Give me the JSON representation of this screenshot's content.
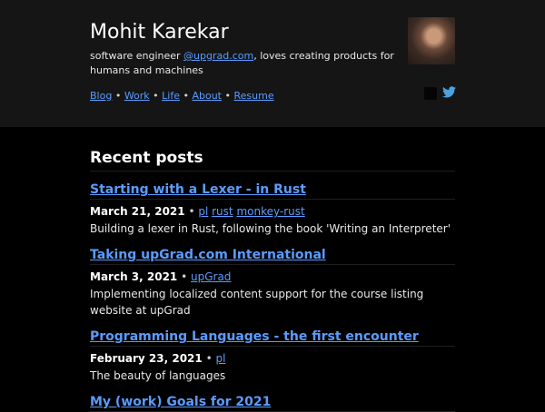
{
  "header": {
    "name": "Mohit Karekar",
    "bio_prefix": "software engineer ",
    "bio_link": "@upgrad.com",
    "bio_suffix": ", loves creating products for humans and machines",
    "nav": [
      "Blog",
      "Work",
      "Life",
      "About",
      "Resume"
    ],
    "nav_separator": " • "
  },
  "social": {
    "icons": [
      "github-icon",
      "twitter-icon"
    ],
    "twitter_color": "#4aa3df"
  },
  "main": {
    "section_title": "Recent posts",
    "posts": [
      {
        "title": "Starting with a Lexer - in Rust",
        "date": "March 21, 2021",
        "tags": [
          "pl",
          "rust",
          "monkey-rust"
        ],
        "description": "Building a lexer in Rust, following the book 'Writing an Interpreter'"
      },
      {
        "title": "Taking upGrad.com International",
        "date": "March 3, 2021",
        "tags": [
          "upGrad"
        ],
        "description": "Implementing localized content support for the course listing website at upGrad"
      },
      {
        "title": "Programming Languages - the first encounter",
        "date": "February 23, 2021",
        "tags": [
          "pl"
        ],
        "description": "The beauty of languages"
      },
      {
        "title": "My (work) Goals for 2021"
      }
    ]
  },
  "colors": {
    "link": "#5b9cff",
    "background": "#000000",
    "header_bg": "#151515"
  }
}
